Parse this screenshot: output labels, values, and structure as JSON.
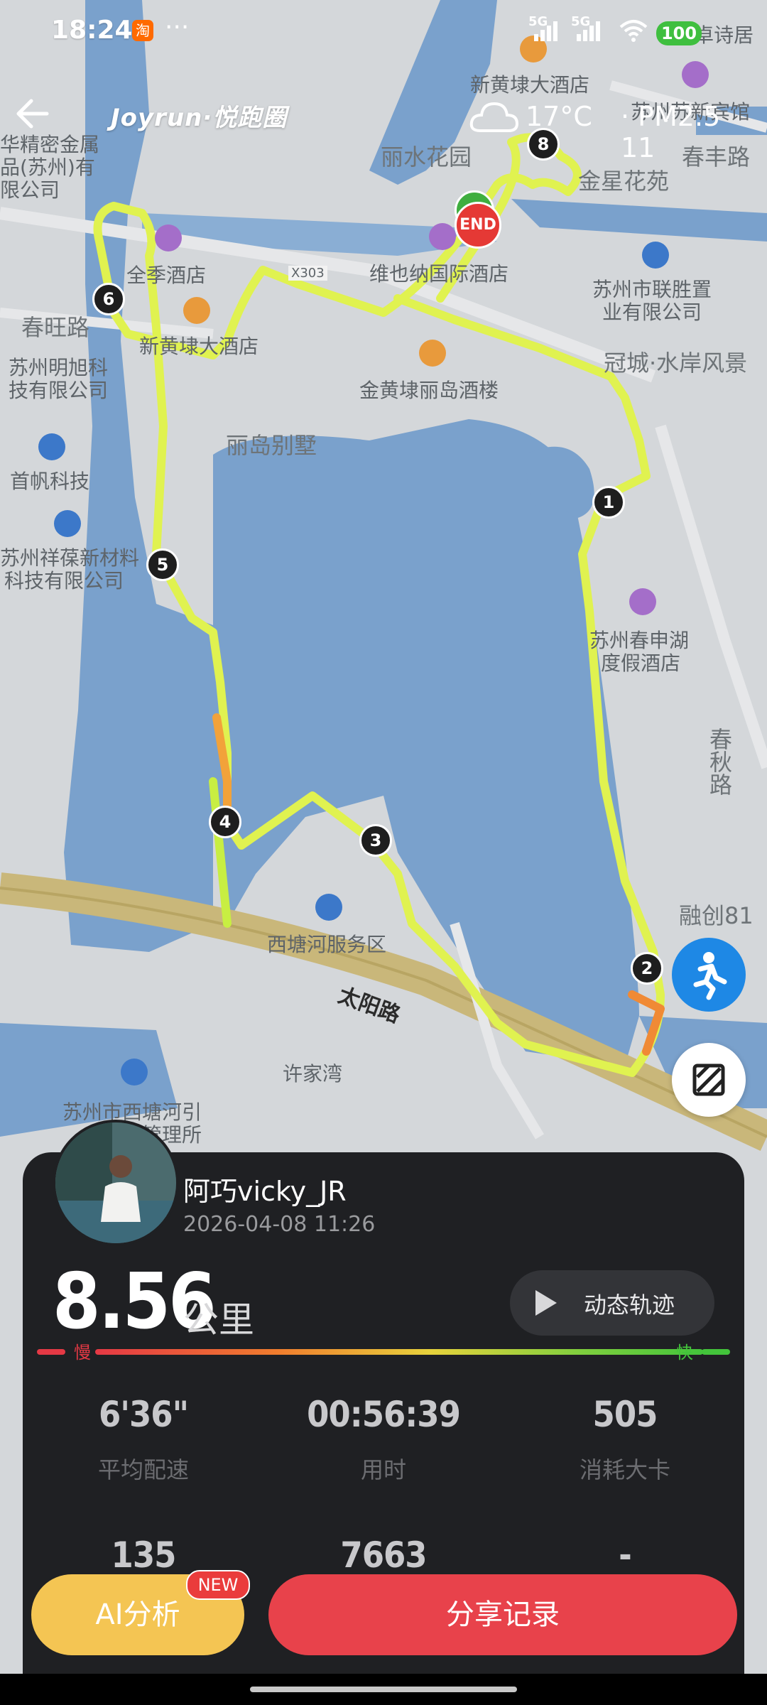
{
  "status_bar": {
    "time": "18:24",
    "app_badge": "淘",
    "more": "···",
    "net1": "5G",
    "net2": "5G",
    "battery": "100"
  },
  "header": {
    "brand": "Joyrun·悦跑圈",
    "temperature": "17°C",
    "air_quality": "· PM2.5 11"
  },
  "map": {
    "labels": {
      "xinhuangdai_restaurant": "新黄埭大酒店",
      "lishui_garden": "丽水花园",
      "jinxing_garden": "金星花苑",
      "vienna_hotel": "维也纳国际酒店",
      "suzhou_lianshengzhi": "苏州市联胜置",
      "lianshengzhi_2": "业有限公司",
      "guancheng": "冠城·水岸风景",
      "jinhuangdai_lidao": "金黄埭丽岛酒楼",
      "lidao_villa": "丽岛别墅",
      "chunwang_road": "春旺路",
      "chunfeng_road": "春丰路",
      "quanji_hotel": "全季酒店",
      "x303": "X303",
      "suzhou_minghuke_1": "苏州明旭科",
      "suzhou_minghuke_2": "技有限公司",
      "shoufan_tech": "首帆科技",
      "suzhou_xiangbao_1": "苏州祥葆新材料",
      "suzhou_xiangbao_2": "科技有限公司",
      "huajingmi_1": "华精密金属",
      "huajingmi_2": "品(苏州)有",
      "huajingmi_3": "限公司",
      "suzhou_chunshen_1": "苏州春申湖",
      "suzhou_chunshen_2": "度假酒店",
      "chunqiu_road": "春秋路",
      "rongchuang": "融创81",
      "xitanghe_service": "西塘河服务区",
      "taiyang_road": "太阳路",
      "xujiawan": "许家湾",
      "xitanghe_1": "苏州市西塘河引",
      "xitanghe_2": "管理所",
      "xinhuangdai_top": "新黄埭大酒店",
      "suzhou_top_right": "苏州苏新宾馆",
      "zhuoshiju": "Y卓诗居"
    },
    "km_markers": [
      "1",
      "2",
      "3",
      "4",
      "5",
      "6",
      "8"
    ],
    "end_label": "END"
  },
  "card": {
    "username": "阿巧vicky_JR",
    "datetime": "2026-04-08 11:26",
    "distance": "8.56",
    "distance_unit": "公里",
    "replay_label": "动态轨迹",
    "pace_slow": "慢",
    "pace_fast": "快",
    "stats": [
      {
        "value": "6'36\"",
        "label": "平均配速"
      },
      {
        "value": "00:56:39",
        "label": "用时"
      },
      {
        "value": "505",
        "label": "消耗大卡"
      },
      {
        "value": "135",
        "label": ""
      },
      {
        "value": "7663",
        "label": ""
      },
      {
        "value": "-",
        "label": ""
      }
    ]
  },
  "actions": {
    "ai_label": "AI分析",
    "ai_badge": "NEW",
    "share_label": "分享记录"
  },
  "colors": {
    "track": "#d9f24a",
    "water": "#6f9ac7",
    "card_bg": "#1f2023",
    "ai_btn": "#f4c553",
    "share_btn": "#e8424b"
  }
}
